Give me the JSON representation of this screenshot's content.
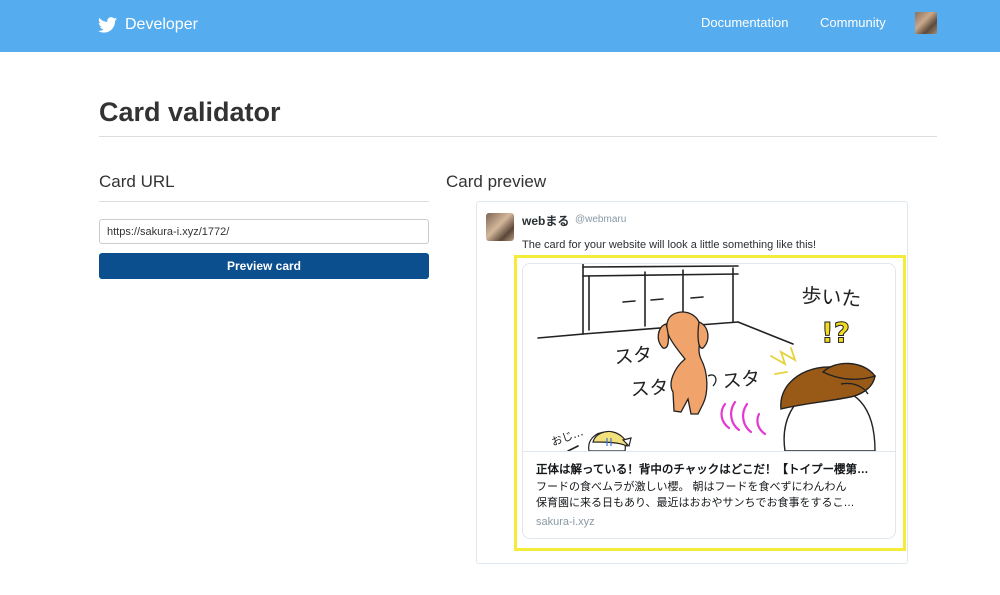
{
  "header": {
    "brand": "Developer",
    "nav": [
      {
        "label": "Documentation"
      },
      {
        "label": "Community"
      }
    ]
  },
  "page": {
    "title": "Card validator"
  },
  "card_url": {
    "heading": "Card URL",
    "input_value": "https://sakura-i.xyz/1772/",
    "button_label": "Preview card"
  },
  "card_preview": {
    "heading": "Card preview",
    "tweet": {
      "name": "webまる",
      "handle": "@webmaru",
      "text": "The card for your website will look a little something like this!"
    },
    "card": {
      "title": "正体は解っている！背中のチャックはどこだ！【トイプー櫻第…",
      "desc_line1": "フードの食べムラが激しい櫻。 朝はフードを食べずにわんわん",
      "desc_line2": "保育園に来る日もあり、最近はおおやサンちでお食事をするこ…",
      "domain": "sakura-i.xyz",
      "image_text": {
        "walk": "歩いた",
        "exclaim": "!?",
        "sta1": "スタ",
        "sta2": "スタ",
        "sta3": "スタ",
        "small": "おじ…"
      }
    }
  },
  "colors": {
    "header": "#55acee",
    "button": "#0c4f8f",
    "highlight": "#f5ec3a"
  }
}
